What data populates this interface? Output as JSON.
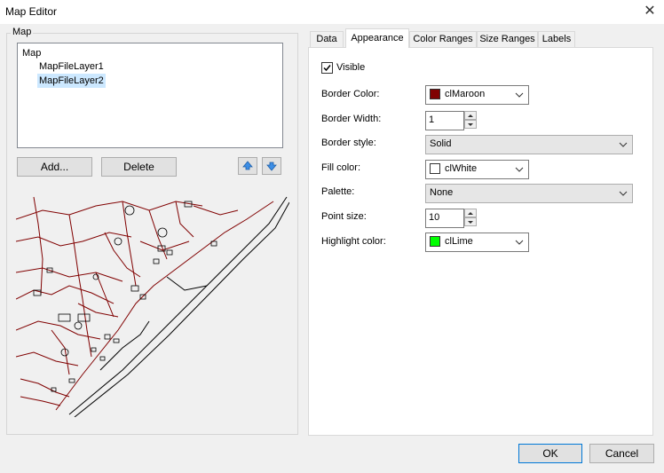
{
  "window": {
    "title": "Map Editor"
  },
  "group": {
    "label": "Map"
  },
  "tree": {
    "nodes": [
      {
        "label": "Map"
      },
      {
        "label": "MapFileLayer1"
      },
      {
        "label": "MapFileLayer2"
      }
    ]
  },
  "buttons": {
    "add": "Add...",
    "delete": "Delete",
    "ok": "OK",
    "cancel": "Cancel"
  },
  "tabs": [
    {
      "label": "Data"
    },
    {
      "label": "Appearance"
    },
    {
      "label": "Color Ranges"
    },
    {
      "label": "Size Ranges"
    },
    {
      "label": "Labels"
    }
  ],
  "active_tab": "Appearance",
  "appearance": {
    "visible_label": "Visible",
    "visible_checked": true,
    "border_color": {
      "label": "Border Color:",
      "value": "clMaroon",
      "swatch": "#800000"
    },
    "border_width": {
      "label": "Border Width:",
      "value": "1"
    },
    "border_style": {
      "label": "Border style:",
      "value": "Solid"
    },
    "fill_color": {
      "label": "Fill color:",
      "value": "clWhite",
      "swatch": "#ffffff"
    },
    "palette": {
      "label": "Palette:",
      "value": "None"
    },
    "point_size": {
      "label": "Point size:",
      "value": "10"
    },
    "highlight_color": {
      "label": "Highlight color:",
      "value": "clLime",
      "swatch": "#00ff00"
    }
  },
  "colors": {
    "road": "#800000",
    "feature": "#000000",
    "selection": "#cce8ff",
    "arrow": "#3c8ee6"
  }
}
